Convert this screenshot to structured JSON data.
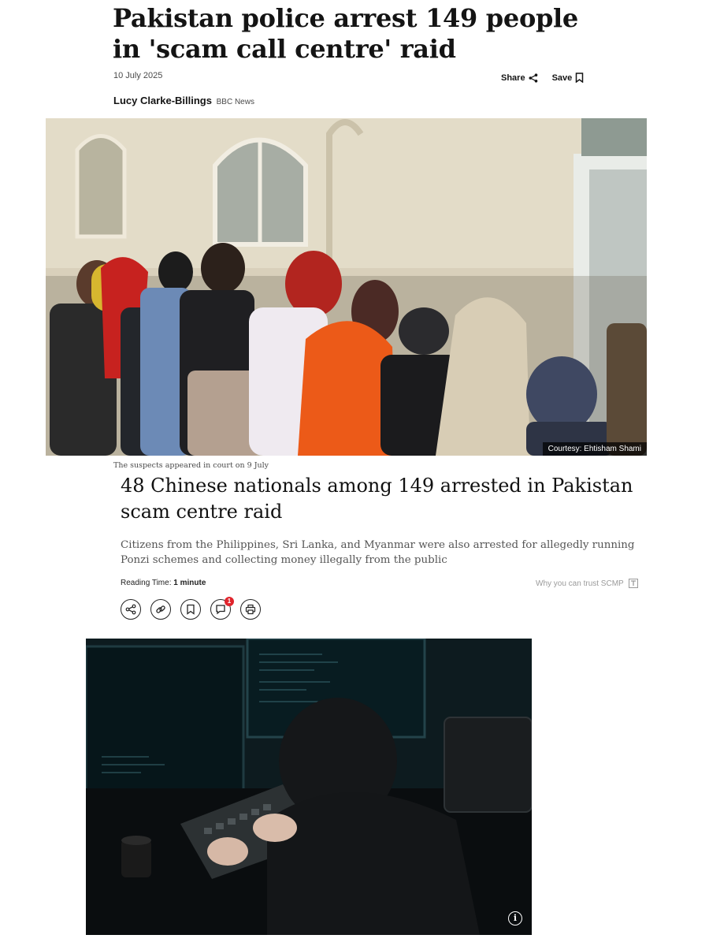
{
  "bbc": {
    "title": "Pakistan police arrest 149 people in 'scam call centre' raid",
    "date": "10 July 2025",
    "share_label": "Share",
    "save_label": "Save",
    "author": "Lucy Clarke-Billings",
    "organization": "BBC News",
    "image_credit": "Courtesy: Ehtisham Shami",
    "image_caption": "The suspects appeared in court on 9 July"
  },
  "scmp": {
    "headline": "48 Chinese nationals among 149 arrested in Pakistan scam centre raid",
    "summary": "Citizens from the Philippines, Sri Lanka, and Myanmar were also arrested for allegedly running Ponzi schemes and collecting money illegally from the public",
    "reading_time_label": "Reading Time:",
    "reading_time_value": "1 minute",
    "trust_link": "Why you can trust SCMP",
    "comment_count": "1",
    "toolbar_icons": [
      "share-icon",
      "link-icon",
      "bookmark-icon",
      "comment-icon",
      "print-icon"
    ],
    "info_label": "i"
  },
  "colors": {
    "text": "#141414",
    "muted": "#4a4a4a",
    "badge": "#e0242c",
    "credit_bg": "#000000"
  }
}
